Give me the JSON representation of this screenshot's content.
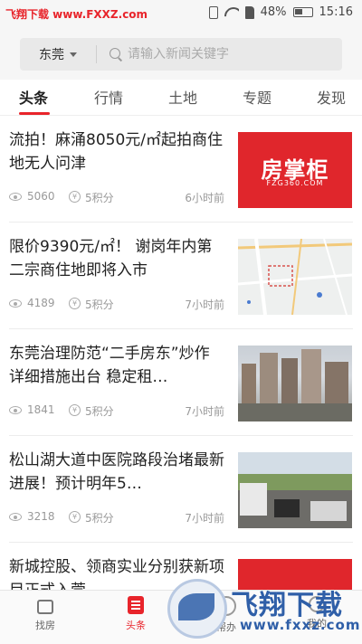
{
  "status_bar": {
    "watermark": "飞翔下载 www.FXXZ.com",
    "battery": "48%",
    "time": "15:16"
  },
  "header": {
    "city": "东莞",
    "search_placeholder": "请输入新闻关键字"
  },
  "tabs": [
    {
      "label": "头条",
      "active": true
    },
    {
      "label": "行情",
      "active": false
    },
    {
      "label": "土地",
      "active": false
    },
    {
      "label": "专题",
      "active": false
    },
    {
      "label": "发现",
      "active": false
    }
  ],
  "news": [
    {
      "title": "流拍！麻涌8050元/㎡起拍商住地无人问津",
      "views": "5060",
      "points": "5积分",
      "time": "6小时前",
      "thumb": "brand",
      "brand_text": "房掌柜",
      "brand_sub": "FZG360.COM"
    },
    {
      "title": "限价9390元/㎡！ 谢岗年内第二宗商住地即将入市",
      "views": "4189",
      "points": "5积分",
      "time": "7小时前",
      "thumb": "map"
    },
    {
      "title": "东莞治理防范“二手房东”炒作详细措施出台 稳定租…",
      "views": "1841",
      "points": "5积分",
      "time": "7小时前",
      "thumb": "city"
    },
    {
      "title": "松山湖大道中医院路段治堵最新进展！预计明年5…",
      "views": "3218",
      "points": "5积分",
      "time": "7小时前",
      "thumb": "road"
    },
    {
      "title": "新城控股、领商实业分别获新项目正式入莞",
      "views": "",
      "points": "",
      "time": "",
      "thumb": "brand",
      "brand_text": "",
      "brand_sub": ""
    }
  ],
  "bottom_nav": [
    {
      "label": "找房",
      "active": false
    },
    {
      "label": "头条",
      "active": true
    },
    {
      "label": "帮办",
      "active": false
    },
    {
      "label": "我的",
      "active": false
    }
  ],
  "overlay": {
    "title": "飞翔下载",
    "url": "www.fxxz.com"
  }
}
